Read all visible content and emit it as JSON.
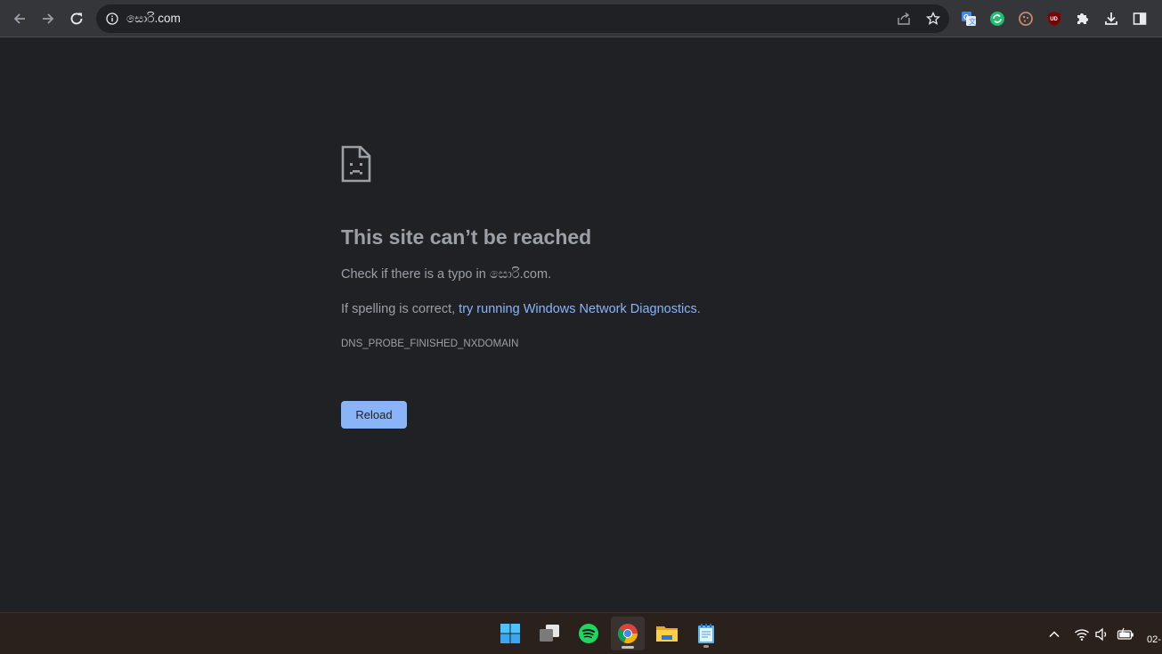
{
  "browser": {
    "url": "සොරි.com",
    "icons": [
      "back-icon",
      "forward-icon",
      "reload-icon",
      "info-icon",
      "share-icon",
      "star-icon",
      "puzzle-icon",
      "download-icon",
      "side-panel-icon"
    ],
    "extensions": [
      "google-translate-icon",
      "green-sync-icon",
      "cookie-icon",
      "ublock-icon"
    ],
    "ublock_badge": "UD"
  },
  "error_page": {
    "title": "This site can’t be reached",
    "check_prefix": "Check if there is a typo in ",
    "check_domain": "සොරි.com",
    "check_suffix": ".",
    "spelling_prefix": "If spelling is correct, ",
    "diagnostics_link": "try running Windows Network Diagnostics",
    "spelling_suffix": ".",
    "error_code": "DNS_PROBE_FINISHED_NXDOMAIN",
    "reload_label": "Reload",
    "icon": "sad-page-icon"
  },
  "taskbar": {
    "apps": [
      "windows-start-icon",
      "task-view-icon",
      "spotify-icon",
      "chrome-icon",
      "file-explorer-icon",
      "notepad-icon"
    ],
    "tray": [
      "chevron-up-icon",
      "wifi-icon",
      "volume-icon",
      "battery-icon"
    ],
    "clock_fragment": "02-"
  },
  "colors": {
    "page_bg": "#202124",
    "toolbar_bg": "#35363a",
    "link": "#8ab4f8",
    "text": "#9aa0a6",
    "button_bg": "#8ab4f8",
    "taskbar_bg": "#2a211d"
  }
}
